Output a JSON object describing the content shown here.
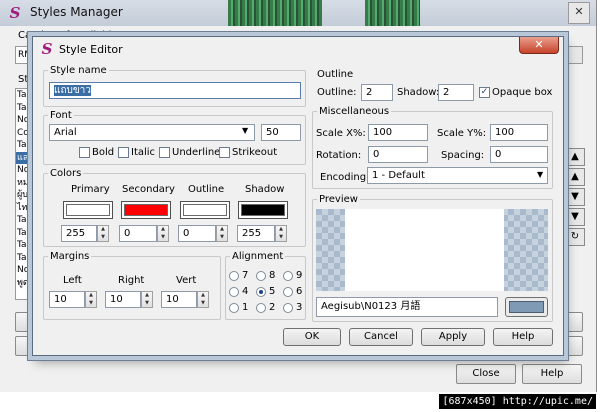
{
  "background_window": {
    "title": "Styles Manager",
    "catalog_label": "Catalog of available storage",
    "catalog_value": "RM",
    "storage_label": "Sto",
    "storage_items": [
      "Ta",
      "Ta",
      "No",
      "Co",
      "Ta",
      "แล",
      "No",
      "หม",
      "ผู้บ",
      "ไท",
      "Ta",
      "Ta",
      "Ta",
      "Ta",
      "No",
      "พูด"
    ],
    "selected_storage_index": 5,
    "side_buttons": [
      "▲",
      "▲",
      "▼",
      "▼",
      "↻"
    ],
    "close_label": "Close",
    "help_label": "Help"
  },
  "dialog": {
    "title": "Style Editor",
    "close_glyph": "✕",
    "style_name": {
      "label": "Style name",
      "value": "แถบขาว"
    },
    "font": {
      "label": "Font",
      "family": "Arial",
      "size": "50",
      "bold": {
        "label": "Bold",
        "checked": false
      },
      "italic": {
        "label": "Italic",
        "checked": false
      },
      "underline": {
        "label": "Underline",
        "checked": false
      },
      "strikeout": {
        "label": "Strikeout",
        "checked": false
      }
    },
    "colors": {
      "label": "Colors",
      "items": [
        {
          "label": "Primary",
          "color": "#ffffff",
          "alpha": "255"
        },
        {
          "label": "Secondary",
          "color": "#ff0000",
          "alpha": "0"
        },
        {
          "label": "Outline",
          "color": "#ffffff",
          "alpha": "0"
        },
        {
          "label": "Shadow",
          "color": "#000000",
          "alpha": "255"
        }
      ]
    },
    "margins": {
      "label": "Margins",
      "left_label": "Left",
      "left": "10",
      "right_label": "Right",
      "right": "10",
      "vert_label": "Vert",
      "vert": "10"
    },
    "alignment": {
      "label": "Alignment",
      "options": [
        "7",
        "8",
        "9",
        "4",
        "5",
        "6",
        "1",
        "2",
        "3"
      ],
      "selected": "5"
    },
    "outline": {
      "label": "Outline",
      "outline_label": "Outline:",
      "outline_value": "2",
      "shadow_label": "Shadow:",
      "shadow_value": "2",
      "opaque_label": "Opaque box",
      "opaque_checked": true
    },
    "misc": {
      "label": "Miscellaneous",
      "scale_x_label": "Scale X%:",
      "scale_x": "100",
      "scale_y_label": "Scale Y%:",
      "scale_y": "100",
      "rotation_label": "Rotation:",
      "rotation": "0",
      "spacing_label": "Spacing:",
      "spacing": "0",
      "encoding_label": "Encoding:",
      "encoding": "1 - Default"
    },
    "preview": {
      "label": "Preview",
      "text": "Aegisub\\N0123 月語",
      "color_button": "#7f9ab5"
    },
    "buttons": {
      "ok": "OK",
      "cancel": "Cancel",
      "apply": "Apply",
      "help": "Help"
    }
  },
  "watermark": "[687x450] http://upic.me/"
}
